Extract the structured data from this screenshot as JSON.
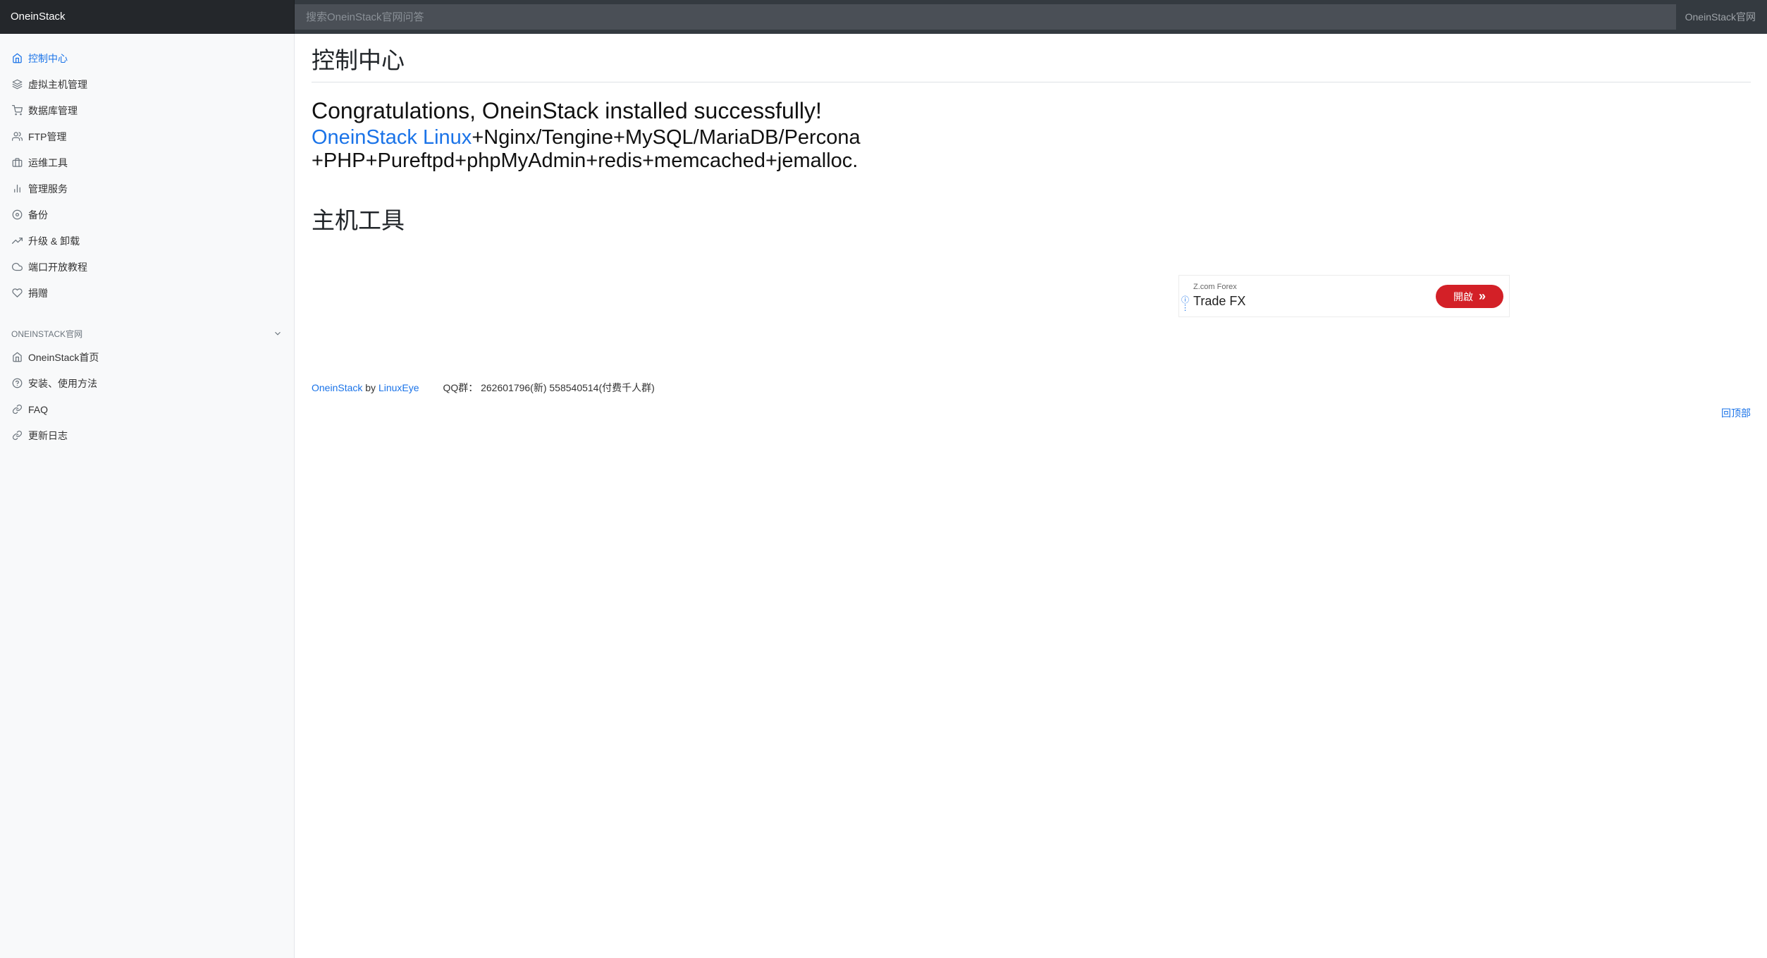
{
  "header": {
    "brand": "OneinStack",
    "search_placeholder": "搜索OneinStack官网问答",
    "site_link": "OneinStack官网"
  },
  "sidebar": {
    "items": [
      {
        "label": "控制中心",
        "icon": "home-icon",
        "active": true
      },
      {
        "label": "虚拟主机管理",
        "icon": "layers-icon"
      },
      {
        "label": "数据库管理",
        "icon": "cart-icon"
      },
      {
        "label": "FTP管理",
        "icon": "users-icon"
      },
      {
        "label": "运维工具",
        "icon": "briefcase-icon"
      },
      {
        "label": "管理服务",
        "icon": "bar-chart-icon"
      },
      {
        "label": "备份",
        "icon": "disc-icon"
      },
      {
        "label": "升级 & 卸载",
        "icon": "trending-up-icon"
      },
      {
        "label": "端口开放教程",
        "icon": "cloud-icon"
      },
      {
        "label": "捐赠",
        "icon": "heart-icon"
      }
    ],
    "section_title": "ONEINSTACK官网",
    "section_items": [
      {
        "label": "OneinStack首页",
        "icon": "home-icon"
      },
      {
        "label": "安装、使用方法",
        "icon": "help-circle-icon"
      },
      {
        "label": "FAQ",
        "icon": "link-icon"
      },
      {
        "label": "更新日志",
        "icon": "link-icon"
      }
    ]
  },
  "main": {
    "title": "控制中心",
    "congrats": "Congratulations, OneinStack installed successfully!",
    "stack_link": "OneinStack Linux",
    "stack_line1": "+Nginx/Tengine+MySQL/MariaDB/Percona",
    "stack_line2": "+PHP+Pureftpd+phpMyAdmin+redis+memcached+jemalloc.",
    "tools_title": "主机工具"
  },
  "ad": {
    "sub": "Z.com Forex",
    "title": "Trade FX",
    "button": "開啟"
  },
  "footer": {
    "link1": "OneinStack",
    "by": "by",
    "link2": "LinuxEye",
    "qq": "QQ群： 262601796(新) 558540514(付费千人群)",
    "back_top": "回顶部"
  },
  "colors": {
    "accent": "#1a73e8",
    "topbar": "#343a40",
    "ad_button": "#d32027"
  }
}
